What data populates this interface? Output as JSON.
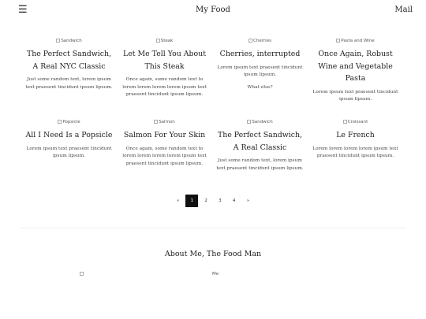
{
  "header": {
    "menu_icon": "☰",
    "title": "My Food",
    "mail_label": "Mail"
  },
  "posts": [
    {
      "img_alt": "Sandwich",
      "title": "The Perfect Sandwich, A Real NYC Classic",
      "text": "Just some random text, lorem ipsum text praesent tincidunt ipsum lipsum.",
      "extra": ""
    },
    {
      "img_alt": "Steak",
      "title": "Let Me Tell You About This Steak",
      "text": "Once again, some random text to lorem lorem lorem lorem ipsum text praesent tincidunt ipsum lipsum.",
      "extra": ""
    },
    {
      "img_alt": "Cherries",
      "title": "Cherries, interrupted",
      "text": "Lorem ipsum text praesent tincidunt ipsum lipsum.",
      "extra": "What else?"
    },
    {
      "img_alt": "Pasta and Wine",
      "title": "Once Again, Robust Wine and Vegetable Pasta",
      "text": "Lorem ipsum text praesent tincidunt ipsum lipsum.",
      "extra": ""
    },
    {
      "img_alt": "Popsicle",
      "title": "All I Need Is a Popsicle",
      "text": "Lorem ipsum text praesent tincidunt ipsum lipsum.",
      "extra": ""
    },
    {
      "img_alt": "Salmon",
      "title": "Salmon For Your Skin",
      "text": "Once again, some random text to lorem lorem lorem lorem ipsum text praesent tincidunt ipsum lipsum.",
      "extra": ""
    },
    {
      "img_alt": "Sandwich",
      "title": "The Perfect Sandwich, A Real Classic",
      "text": "Just some random text, lorem ipsum text praesent tincidunt ipsum lipsum.",
      "extra": ""
    },
    {
      "img_alt": "Croissant",
      "title": "Le French",
      "text": "Lorem lorem lorem lorem ipsum text praesent tincidunt ipsum lipsum.",
      "extra": ""
    }
  ],
  "pagination": {
    "prev": "«",
    "pages": [
      "1",
      "2",
      "3",
      "4"
    ],
    "next": "»",
    "active": "1"
  },
  "about": {
    "title": "About Me, The Food Man",
    "img_alt": "Me"
  }
}
